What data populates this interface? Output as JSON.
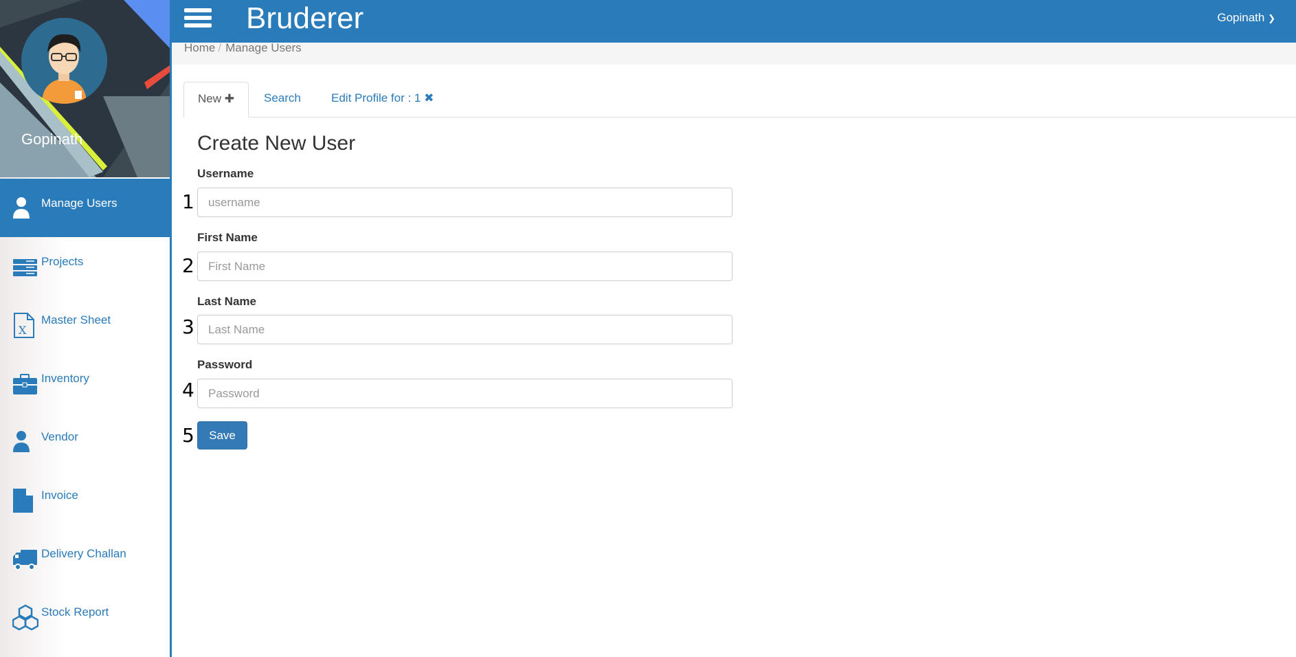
{
  "app": {
    "brand": "Bruderer",
    "user_menu": "Gopinath",
    "user_menu_icon": "chevron-down-icon"
  },
  "profile": {
    "name": "Gopinath"
  },
  "sidebar": {
    "items": [
      {
        "label": "Manage Users",
        "icon": "user-icon",
        "active": true
      },
      {
        "label": "Projects",
        "icon": "server-icon"
      },
      {
        "label": "Master Sheet",
        "icon": "excel-file-icon"
      },
      {
        "label": "Inventory",
        "icon": "briefcase-icon"
      },
      {
        "label": "Vendor",
        "icon": "user-icon"
      },
      {
        "label": "Invoice",
        "icon": "file-icon"
      },
      {
        "label": "Delivery Challan",
        "icon": "truck-icon"
      },
      {
        "label": "Stock Report",
        "icon": "cubes-icon"
      }
    ]
  },
  "breadcrumb": {
    "home": "Home",
    "sep": "/",
    "current": "Manage Users"
  },
  "tabs": [
    {
      "label": "New",
      "glyph": "✚",
      "active": true
    },
    {
      "label": "Search"
    },
    {
      "label": "Edit Profile for : 1",
      "glyph": "✖"
    }
  ],
  "form": {
    "title": "Create New User",
    "fields": [
      {
        "label": "Username",
        "placeholder": "username",
        "marker": "1"
      },
      {
        "label": "First Name",
        "placeholder": "First Name",
        "marker": "2"
      },
      {
        "label": "Last Name",
        "placeholder": "Last Name",
        "marker": "3"
      },
      {
        "label": "Password",
        "placeholder": "Password",
        "marker": "4"
      }
    ],
    "save_label": "Save",
    "save_marker": "5"
  },
  "colors": {
    "primary": "#2a7bb9",
    "button": "#337ab7"
  }
}
